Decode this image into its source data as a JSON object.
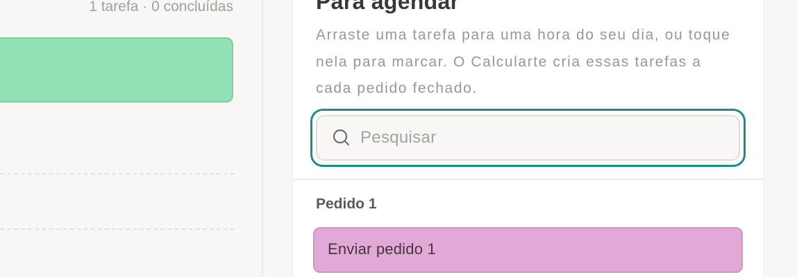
{
  "schedule": {
    "summary": "1 tarefa · 0 concluídas",
    "block_color": "#93e1b6"
  },
  "sidebar": {
    "title": "Para agendar",
    "description": "Arraste uma tarefa para uma hora do seu dia, ou toque nela para marcar. O Calcularte cria essas tarefas a cada pedido fechado.",
    "search": {
      "placeholder": "Pesquisar",
      "value": "",
      "icon": "search-icon",
      "focus_color": "#1f8a87"
    },
    "groups": [
      {
        "label": "Pedido 1",
        "tasks": [
          {
            "label": "Enviar pedido 1",
            "color": "#e1a9d6"
          }
        ]
      }
    ]
  }
}
